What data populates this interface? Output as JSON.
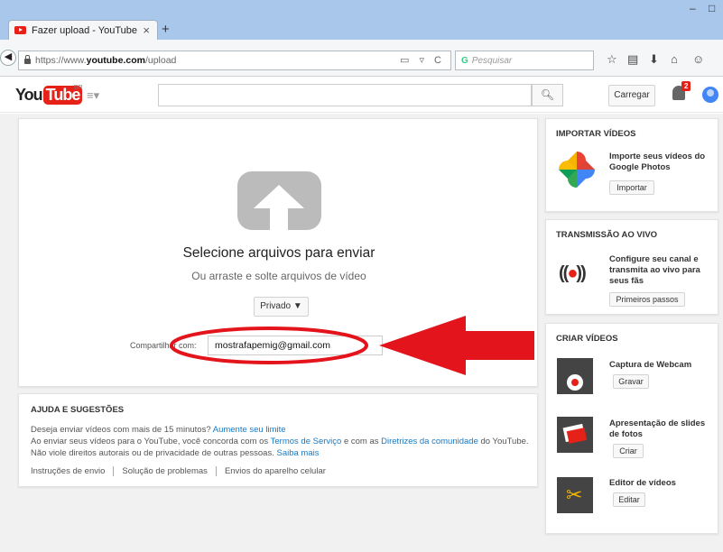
{
  "browser": {
    "tab_title": "Fazer upload - YouTube",
    "tab_close": "×",
    "new_tab": "+",
    "url_host": "https://www.",
    "url_domain": "youtube.com",
    "url_path": "/upload",
    "search_placeholder": "Pesquisar",
    "window_min": "–",
    "window_restore": "□"
  },
  "header": {
    "logo_you": "You",
    "logo_tube": "Tube",
    "region": "BR",
    "upload_label": "Carregar",
    "notification_count": "2"
  },
  "upload": {
    "title": "Selecione arquivos para enviar",
    "subtitle": "Ou arraste e solte arquivos de vídeo",
    "privacy_label": "Privado ▼",
    "share_label": "Compartilhar com:",
    "share_value": "mostrafapemig@gmail.com"
  },
  "help": {
    "title": "AJUDA E SUGESTÕES",
    "line1_text": "Deseja enviar vídeos com mais de 15 minutos?",
    "line1_link": "Aumente seu limite",
    "line2_a": "Ao enviar seus vídeos para o YouTube, você concorda com os",
    "line2_link1": "Termos de Serviço",
    "line2_b": "e com as",
    "line2_link2": "Diretrizes da comunidade",
    "line2_c": "do YouTube.",
    "line3_text": "Não viole direitos autorais ou de privacidade de outras pessoas.",
    "line3_link": "Saiba mais",
    "links": [
      "Instruções de envio",
      "Solução de problemas",
      "Envios do aparelho celular"
    ]
  },
  "sidebar": {
    "import": {
      "title": "IMPORTAR VÍDEOS",
      "text": "Importe seus vídeos do Google Photos",
      "button": "Importar"
    },
    "live": {
      "title": "TRANSMISSÃO AO VIVO",
      "text": "Configure seu canal e transmita ao vivo para seus fãs",
      "button": "Primeiros passos"
    },
    "create": {
      "title": "CRIAR VÍDEOS",
      "items": [
        {
          "label": "Captura de Webcam",
          "button": "Gravar"
        },
        {
          "label": "Apresentação de slides de fotos",
          "button": "Criar"
        },
        {
          "label": "Editor de vídeos",
          "button": "Editar"
        }
      ]
    }
  },
  "colors": {
    "brand_red": "#e62117",
    "link_blue": "#167ac6",
    "annotation_red": "#e3141b"
  }
}
